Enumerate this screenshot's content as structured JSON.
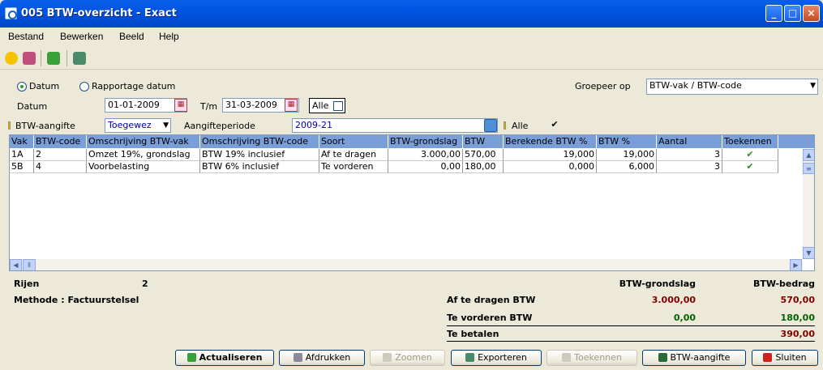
{
  "window": {
    "title": "005 BTW-overzicht - Exact",
    "minimize": "_",
    "maximize": "□",
    "close": "×"
  },
  "menu": [
    "Bestand",
    "Bewerken",
    "Beeld",
    "Help"
  ],
  "filters": {
    "radio_datum": "Datum",
    "radio_rapportage": "Rapportage datum",
    "groepeer_label": "Groepeer op",
    "groepeer_value": "BTW-vak / BTW-code",
    "datum_label": "Datum",
    "datum_from": "01-01-2009",
    "tm_label": "T/m",
    "datum_to": "31-03-2009",
    "alle_label": "Alle",
    "aangifte_label": "BTW-aangifte",
    "aangifte_value": "Toegewez",
    "periode_label": "Aangifteperiode",
    "periode_value": "2009-21",
    "alle2_label": "Alle",
    "alle2_check": "✔"
  },
  "table": {
    "columns": [
      "Vak",
      "BTW-code",
      "Omschrijving BTW-vak",
      "Omschrijving BTW-code",
      "Soort",
      "BTW-grondslag",
      "BTW",
      "Berekende BTW %",
      "BTW %",
      "Aantal",
      "Toekennen"
    ],
    "rows": [
      [
        "1A",
        "2",
        "Omzet 19%, grondslag",
        "BTW 19% inclusief",
        "Af te dragen",
        "3.000,00",
        "570,00",
        "19,000",
        "19,000",
        "3",
        "✔"
      ],
      [
        "5B",
        "4",
        "Voorbelasting",
        "BTW 6% inclusief",
        "Te vorderen",
        "0,00",
        "180,00",
        "0,000",
        "6,000",
        "3",
        "✔"
      ]
    ]
  },
  "summary": {
    "rijen_label": "Rijen",
    "rijen_value": "2",
    "methode": "Methode : Factuurstelsel",
    "col_grondslag": "BTW-grondslag",
    "col_bedrag": "BTW-bedrag",
    "af_label": "Af te dragen BTW",
    "af_grondslag": "3.000,00",
    "af_bedrag": "570,00",
    "te_label": "Te vorderen BTW",
    "te_grondslag": "0,00",
    "te_bedrag": "180,00",
    "betalen_label": "Te betalen",
    "betalen_bedrag": "390,00"
  },
  "buttons": {
    "actualiseren": "Actualiseren",
    "afdrukken": "Afdrukken",
    "zoomen": "Zoomen",
    "exporteren": "Exporteren",
    "toekennen": "Toekennen",
    "btw_aangifte": "BTW-aangifte",
    "sluiten": "Sluiten"
  },
  "colors": {
    "header": "#7a9ed8",
    "af": "#800000",
    "te": "#006400",
    "betalen": "#800000"
  }
}
